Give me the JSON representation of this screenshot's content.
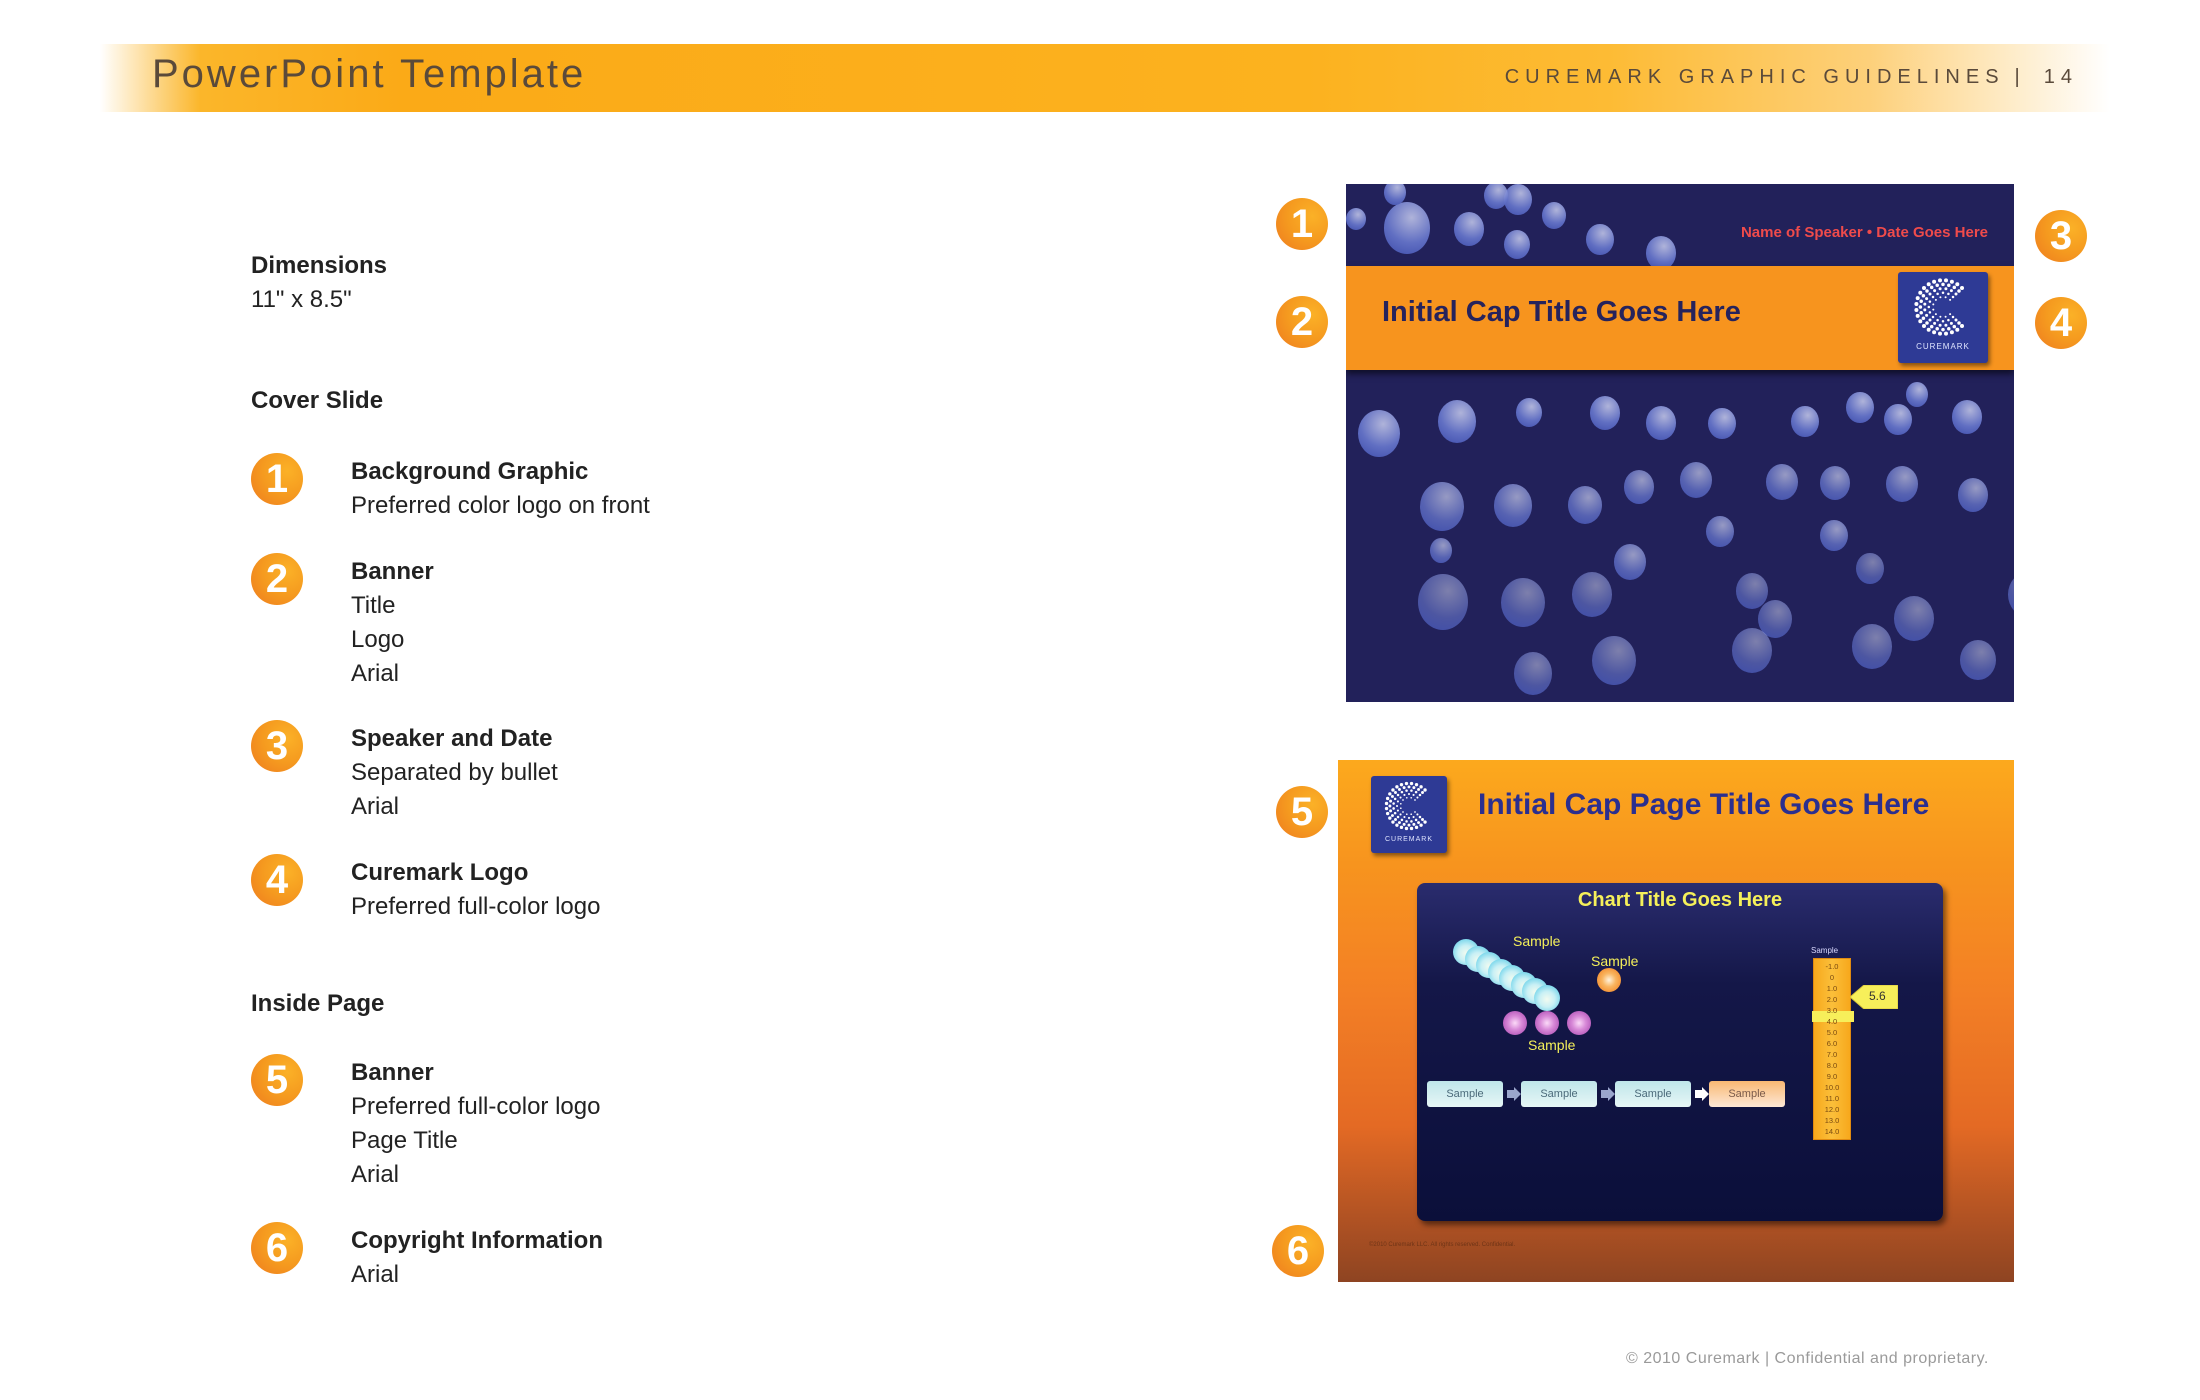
{
  "header": {
    "title": "PowerPoint Template",
    "guide_name": "CUREMARK GRAPHIC GUIDELINES",
    "separator": "|",
    "page_number": "14"
  },
  "left_column": {
    "dimensions": {
      "heading": "Dimensions",
      "value": "11\" x 8.5\""
    },
    "cover_slide": {
      "heading": "Cover Slide",
      "items": [
        {
          "number": "1",
          "label": "Background Graphic",
          "lines": [
            "Preferred color logo on front"
          ]
        },
        {
          "number": "2",
          "label": "Banner",
          "lines": [
            "Title",
            "Logo",
            "Arial"
          ]
        },
        {
          "number": "3",
          "label": "Speaker and Date",
          "lines": [
            "Separated by bullet",
            "Arial"
          ]
        },
        {
          "number": "4",
          "label": "Curemark Logo",
          "lines": [
            "Preferred full-color logo"
          ]
        }
      ]
    },
    "inside_page": {
      "heading": "Inside Page",
      "items": [
        {
          "number": "5",
          "label": "Banner",
          "lines": [
            "Preferred full-color logo",
            "Page Title",
            "Arial"
          ]
        },
        {
          "number": "6",
          "label": "Copyright Information",
          "lines": [
            "Arial"
          ]
        }
      ]
    }
  },
  "cover_slide_preview": {
    "speaker_date": "Name of Speaker • Date Goes Here",
    "title": "Initial Cap Title Goes Here",
    "logo_text": "CUREMARK",
    "badges": [
      "1",
      "2",
      "3",
      "4"
    ],
    "colors": {
      "background": "#22215a",
      "banner": "#f7941e",
      "title": "#26235c",
      "speaker": "#ef4b4b"
    }
  },
  "inside_page_preview": {
    "logo_text": "CUREMARK",
    "title": "Initial Cap Page Title Goes Here",
    "chart_title": "Chart Title Goes Here",
    "sample_labels": [
      "Sample",
      "Sample",
      "Sample"
    ],
    "scale": {
      "header": "Sample",
      "ticks": [
        "-1.0",
        "0",
        "1.0",
        "2.0",
        "3.0",
        "4.0",
        "5.0",
        "6.0",
        "7.0",
        "8.0",
        "9.0",
        "10.0",
        "11.0",
        "12.0",
        "13.0",
        "14.0"
      ],
      "callout_value": "5.6"
    },
    "flow_steps": [
      "Sample",
      "Sample",
      "Sample",
      "Sample"
    ],
    "copyright": "©2010 Curemark LLC. All rights reserved. Confidential.",
    "badges": [
      "5",
      "6"
    ]
  },
  "footer": {
    "text": "© 2010 Curemark | Confidential and proprietary."
  },
  "colors": {
    "accent_orange": "#f7941e",
    "navy": "#22215a",
    "chart_yellow": "#f5f05a"
  }
}
